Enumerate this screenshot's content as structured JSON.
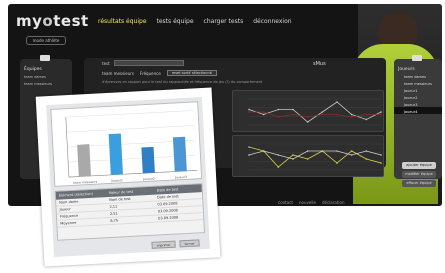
{
  "app": {
    "logo_left": "my",
    "logo_mid": "o",
    "logo_right": "test"
  },
  "nav": {
    "items": [
      "résultats équipe",
      "tests équipe",
      "charger tests",
      "déconnexion"
    ]
  },
  "mode_button": "mode athlète",
  "left_panel": {
    "title": "Équipes",
    "items": [
      "team dames",
      "team messieurs"
    ]
  },
  "right_panel": {
    "title": "Joueurs",
    "items": [
      "team dames",
      "team messieurs",
      "Joueur1",
      "Joueur2",
      "Joueur3",
      "Joueur4"
    ]
  },
  "right_buttons": [
    "ajouter équipe",
    "modifier équipe",
    "effacer équipe"
  ],
  "test_row": {
    "label": "test",
    "choice_a": "team messieurs",
    "choice_b": "Fréquence",
    "button": "reset sortif sélectionné"
  },
  "sub_text": "d'épreuves en rapport pour le test du rapprochée et fréquence de jeu (?) du comportement",
  "signature": "sMus",
  "footer": [
    "contact",
    "nouvelle",
    "déclaration"
  ],
  "photo": {
    "table_header": [
      "Élément (sélection)",
      "Valeur de test",
      "Date de test"
    ],
    "rows": [
      [
        "Nom dame",
        "Nom de test",
        "Date de test"
      ],
      [
        "Joueur",
        "2,11",
        "03.09.2008"
      ],
      [
        "Fréquence",
        "2,51",
        "03.09.2008"
      ],
      [
        "Moyenne",
        "8,75",
        "03.09.2008"
      ]
    ],
    "buttons": [
      "imprimer",
      "fermer"
    ]
  },
  "chart_data": [
    {
      "type": "bar",
      "categories": [
        "team messieurs",
        "Joueur1",
        "Joueur2",
        "Joueur3"
      ],
      "values": [
        0.53,
        0.68,
        0.43,
        0.57
      ],
      "ylim": [
        0,
        1
      ]
    },
    {
      "type": "line",
      "series": [
        {
          "values": [
            -0.1,
            -0.2,
            -0.1,
            -0.1,
            -0.35,
            -0.15,
            0.05,
            -0.2,
            -0.3,
            -0.15
          ]
        },
        {
          "values": [
            -0.15,
            -0.15,
            -0.25,
            -0.2,
            -0.25,
            -0.2,
            -0.2,
            -0.25,
            -0.2,
            -0.2
          ]
        }
      ]
    },
    {
      "type": "line",
      "series": [
        {
          "values": [
            0.7,
            0.6,
            0.2,
            0.5,
            0.4,
            0.6,
            0.3,
            0.6,
            0.4,
            0.3
          ]
        },
        {
          "values": [
            0.5,
            0.6,
            0.5,
            0.4,
            0.6,
            0.6,
            0.6,
            0.5,
            0.6,
            0.5
          ]
        }
      ]
    }
  ]
}
